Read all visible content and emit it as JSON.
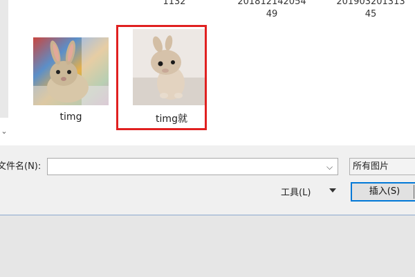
{
  "file_list": {
    "top_labels": [
      {
        "lines": [
          "1132"
        ]
      },
      {
        "lines": [
          "201812142054",
          "49"
        ]
      },
      {
        "lines": [
          "201903201313",
          "45"
        ]
      }
    ],
    "files": [
      {
        "name": "timg",
        "thumbnail": "rabbit-colorful-blanket",
        "selected": false
      },
      {
        "name": "timg就",
        "thumbnail": "rabbit-light-background",
        "selected": true
      }
    ],
    "scroll_icon": "chevron-down-icon",
    "scroll_glyph": "⌄"
  },
  "footer": {
    "filename_label": "文件名(N):",
    "filename_value": "",
    "filetype_value": "所有图片",
    "tools_label": "工具(L)",
    "insert_label": "插入(S)"
  },
  "colors": {
    "selection": "#e02020",
    "accent": "#0078d7"
  }
}
